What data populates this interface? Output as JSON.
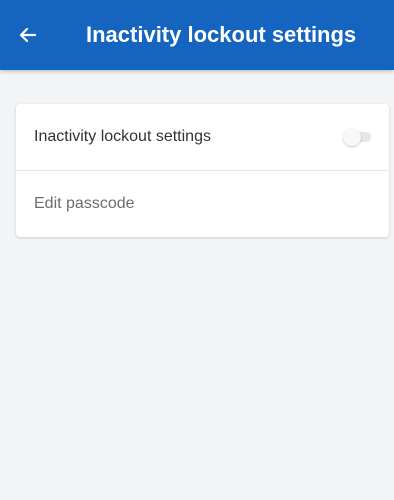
{
  "header": {
    "title": "Inactivity lockout settings",
    "back_icon": "arrow-left-icon",
    "background_color": "#1565c0"
  },
  "settings": {
    "items": [
      {
        "label": "Inactivity lockout settings",
        "control": "toggle",
        "enabled": false
      },
      {
        "label": "Edit passcode"
      }
    ]
  }
}
